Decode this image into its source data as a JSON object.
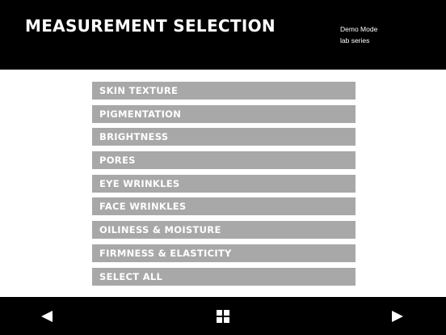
{
  "header": {
    "title": "MEASUREMENT SELECTION",
    "mode": "Demo Mode",
    "series": "lab series"
  },
  "measurements": [
    "SKIN TEXTURE",
    "PIGMENTATION",
    "BRIGHTNESS",
    "PORES",
    "EYE WRINKLES",
    "FACE WRINKLES",
    "OILINESS & MOISTURE",
    "FIRMNESS & ELASTICITY",
    "SELECT ALL"
  ],
  "footer": {
    "icons": [
      "back-arrow-icon",
      "home-grid-icon",
      "next-arrow-icon"
    ]
  },
  "colors": {
    "header_bg": "#000000",
    "item_bg": "#a8a8a8",
    "text": "#ffffff"
  }
}
